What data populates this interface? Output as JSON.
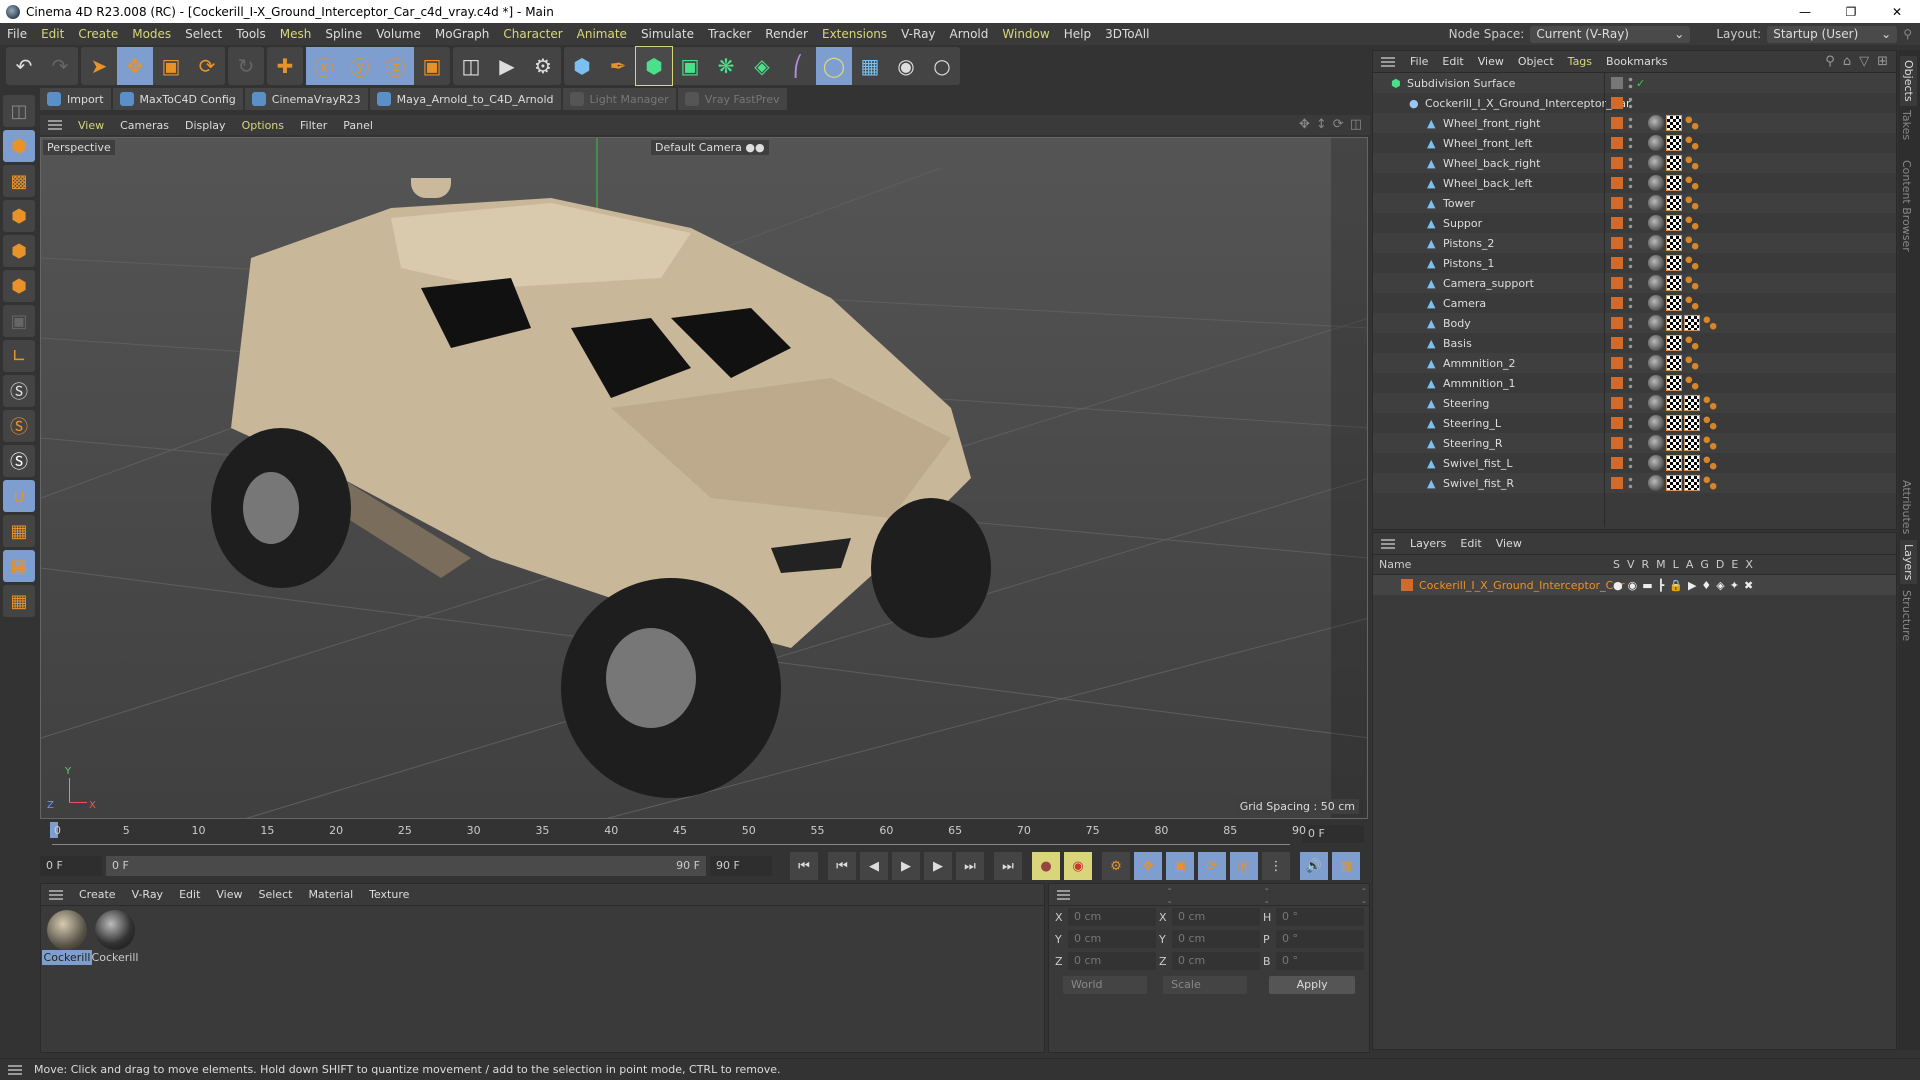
{
  "title": "Cinema 4D R23.008 (RC) - [Cockerill_I-X_Ground_Interceptor_Car_c4d_vray.c4d *] - Main",
  "window_controls": [
    "minimize",
    "restore",
    "close"
  ],
  "menu": [
    {
      "label": "File",
      "hl": false
    },
    {
      "label": "Edit",
      "hl": true
    },
    {
      "label": "Create",
      "hl": true
    },
    {
      "label": "Modes",
      "hl": true
    },
    {
      "label": "Select",
      "hl": false
    },
    {
      "label": "Tools",
      "hl": false
    },
    {
      "label": "Mesh",
      "hl": true
    },
    {
      "label": "Spline",
      "hl": false
    },
    {
      "label": "Volume",
      "hl": false
    },
    {
      "label": "MoGraph",
      "hl": false
    },
    {
      "label": "Character",
      "hl": true
    },
    {
      "label": "Animate",
      "hl": true
    },
    {
      "label": "Simulate",
      "hl": false
    },
    {
      "label": "Tracker",
      "hl": false
    },
    {
      "label": "Render",
      "hl": false
    },
    {
      "label": "Extensions",
      "hl": true
    },
    {
      "label": "V-Ray",
      "hl": false
    },
    {
      "label": "Arnold",
      "hl": false
    },
    {
      "label": "Window",
      "hl": true
    },
    {
      "label": "Help",
      "hl": false
    },
    {
      "label": "3DToAll",
      "hl": false
    }
  ],
  "node_space": {
    "label": "Node Space:",
    "value": "Current (V-Ray)"
  },
  "layout": {
    "label": "Layout:",
    "value": "Startup (User)"
  },
  "plugins": [
    {
      "label": "Import",
      "dim": false
    },
    {
      "label": "MaxToC4D Config",
      "dim": false
    },
    {
      "label": "CinemaVrayR23",
      "dim": false
    },
    {
      "label": "Maya_Arnold_to_C4D_Arnold",
      "dim": false
    },
    {
      "label": "Light Manager",
      "dim": true
    },
    {
      "label": "Vray FastPrev",
      "dim": true
    }
  ],
  "viewport": {
    "menu": [
      {
        "label": "View",
        "hl": true
      },
      {
        "label": "Cameras",
        "hl": false
      },
      {
        "label": "Display",
        "hl": false
      },
      {
        "label": "Options",
        "hl": true
      },
      {
        "label": "Filter",
        "hl": false
      },
      {
        "label": "Panel",
        "hl": false
      }
    ],
    "projection": "Perspective",
    "camera": "Default Camera",
    "grid_spacing": "Grid Spacing : 50 cm"
  },
  "timeline": {
    "ticks": [
      "0",
      "5",
      "10",
      "15",
      "20",
      "25",
      "30",
      "35",
      "40",
      "45",
      "50",
      "55",
      "60",
      "65",
      "70",
      "75",
      "80",
      "85",
      "90"
    ],
    "current_frame": "0 F",
    "start_field": "0 F",
    "slider_start": "0 F",
    "slider_end": "90 F",
    "end_field": "90 F"
  },
  "material_manager": {
    "menu": [
      "Create",
      "V-Ray",
      "Edit",
      "View",
      "Select",
      "Material",
      "Texture"
    ],
    "materials": [
      {
        "name": "Cockerill",
        "selected": true
      },
      {
        "name": "Cockerill",
        "selected": false
      }
    ]
  },
  "coordinates": {
    "headers": [
      "--",
      "--",
      "--"
    ],
    "rows": [
      {
        "a": "X",
        "av": "0 cm",
        "b": "X",
        "bv": "0 cm",
        "c": "H",
        "cv": "0 °"
      },
      {
        "a": "Y",
        "av": "0 cm",
        "b": "Y",
        "bv": "0 cm",
        "c": "P",
        "cv": "0 °"
      },
      {
        "a": "Z",
        "av": "0 cm",
        "b": "Z",
        "bv": "0 cm",
        "c": "B",
        "cv": "0 °"
      }
    ],
    "mode": "World",
    "size_mode": "Scale",
    "apply": "Apply"
  },
  "object_manager": {
    "menu": [
      {
        "label": "File",
        "hl": false
      },
      {
        "label": "Edit",
        "hl": false
      },
      {
        "label": "View",
        "hl": false
      },
      {
        "label": "Object",
        "hl": false
      },
      {
        "label": "Tags",
        "hl": true
      },
      {
        "label": "Bookmarks",
        "hl": false
      }
    ],
    "root": "Subdivision Surface",
    "group": "Cockerill_I_X_Ground_Interceptor_Car",
    "objects": [
      {
        "name": "Wheel_front_right",
        "tags": 3
      },
      {
        "name": "Wheel_front_left",
        "tags": 3
      },
      {
        "name": "Wheel_back_right",
        "tags": 3
      },
      {
        "name": "Wheel_back_left",
        "tags": 3
      },
      {
        "name": "Tower",
        "tags": 3
      },
      {
        "name": "Suppor",
        "tags": 3
      },
      {
        "name": "Pistons_2",
        "tags": 3
      },
      {
        "name": "Pistons_1",
        "tags": 3
      },
      {
        "name": "Camera_support",
        "tags": 3
      },
      {
        "name": "Camera",
        "tags": 3
      },
      {
        "name": "Body",
        "tags": 4
      },
      {
        "name": "Basis",
        "tags": 3
      },
      {
        "name": "Ammnition_2",
        "tags": 3
      },
      {
        "name": "Ammnition_1",
        "tags": 3
      },
      {
        "name": "Steering",
        "tags": 4
      },
      {
        "name": "Steering_L",
        "tags": 4
      },
      {
        "name": "Steering_R",
        "tags": 4
      },
      {
        "name": "Swivel_fist_L",
        "tags": 4
      },
      {
        "name": "Swivel_fist_R",
        "tags": 4
      }
    ]
  },
  "layer_manager": {
    "menu": [
      "Layers",
      "Edit",
      "View"
    ],
    "name_header": "Name",
    "columns": [
      "S",
      "V",
      "R",
      "M",
      "L",
      "A",
      "G",
      "D",
      "E",
      "X"
    ],
    "layers": [
      {
        "name": "Cockerill_I_X_Ground_Interceptor_Car",
        "color": "#d26a2b"
      }
    ]
  },
  "side_tabs": [
    {
      "label": "Objects",
      "active": true
    },
    {
      "label": "Takes",
      "active": false
    },
    {
      "label": "Content Browser",
      "active": false
    },
    {
      "label": "Attributes",
      "active": false
    },
    {
      "label": "Layers",
      "active": true
    },
    {
      "label": "Structure",
      "active": false
    }
  ],
  "status": "Move: Click and drag to move elements. Hold down SHIFT to quantize movement / add to the selection in point mode, CTRL to remove.",
  "colors": {
    "accent_orange": "#e8922a",
    "selection_blue": "#7e9ecf",
    "highlight_yellow": "#d7d77a",
    "layer_orange": "#d26a2b"
  }
}
